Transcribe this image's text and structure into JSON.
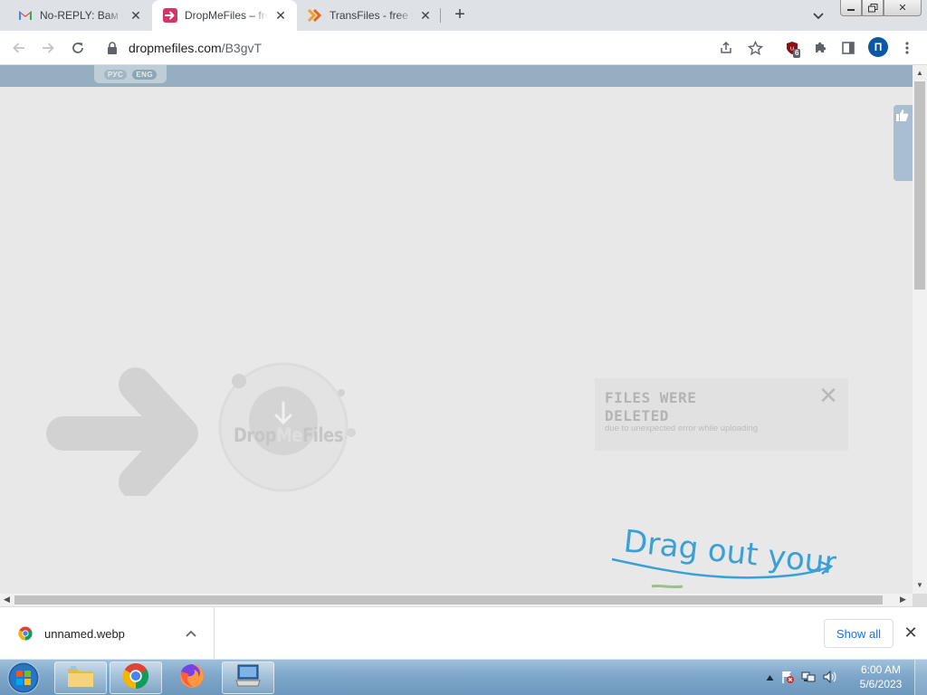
{
  "browser": {
    "tabs": [
      {
        "title": "No-REPLY: Вам от",
        "favicon": "gmail-icon",
        "active": false
      },
      {
        "title": "DropMeFiles – fre",
        "favicon": "dropmefiles-icon",
        "active": true
      },
      {
        "title": "TransFiles - free fi",
        "favicon": "transfiles-icon",
        "active": false
      }
    ],
    "url_host": "dropmefiles.com",
    "url_path": "/B3gvT",
    "extension_badge": "6",
    "profile_initial": "П"
  },
  "page": {
    "lang_options": [
      "РУС",
      "ENG"
    ],
    "logo": {
      "part1": "Drop",
      "part2": "Me",
      "part3": "Files"
    },
    "notice": {
      "title": "FILES WERE DELETED",
      "subtitle": "due to unexpected error while uploading"
    },
    "drag_text": "Drag out your"
  },
  "download_bar": {
    "file_name": "unnamed.webp",
    "show_all_label": "Show all"
  },
  "taskbar": {
    "time": "6:00 AM",
    "date": "5/6/2023"
  },
  "colors": {
    "header_band": "#96afc0",
    "page_bg": "#e8e8e8",
    "drag_text_blue": "#3aa0d8",
    "accent_link": "#1a73e8"
  }
}
